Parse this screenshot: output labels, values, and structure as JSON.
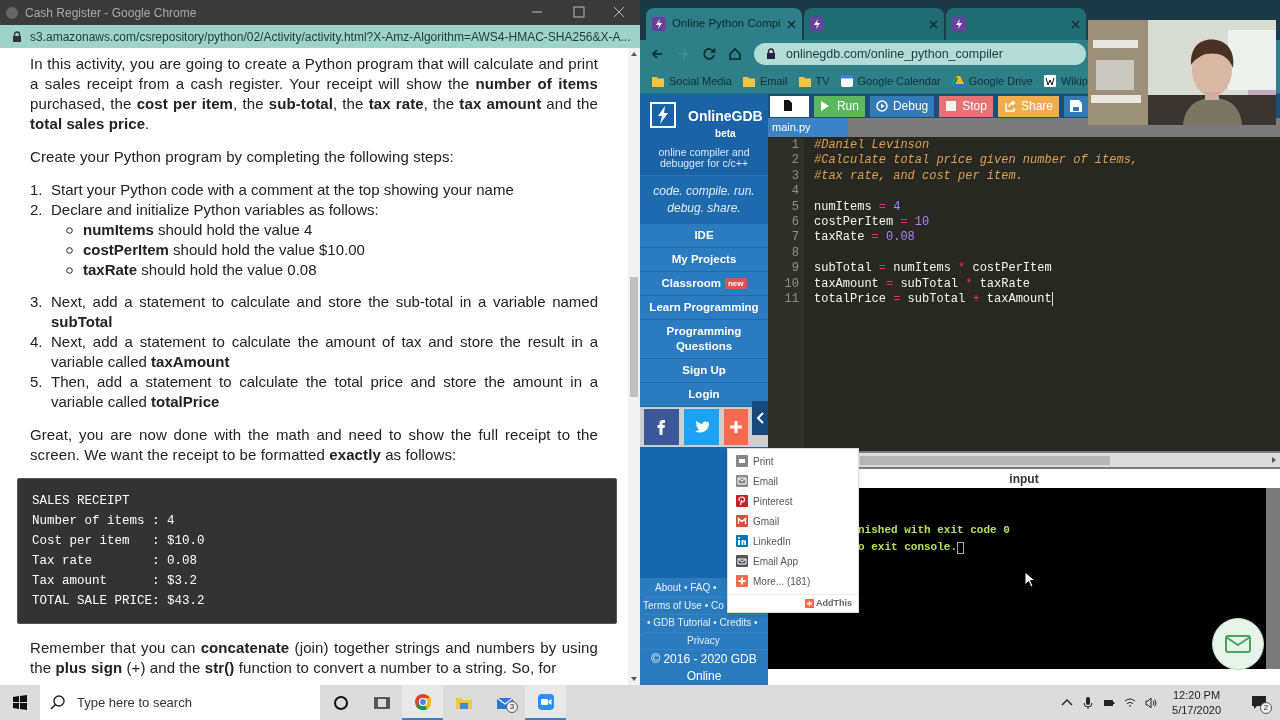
{
  "left_window": {
    "title": "Cash Register - Google Chrome",
    "url": "s3.amazonaws.com/csrepository/python/02/Activity/activity.html?X-Amz-Algorithm=AWS4-HMAC-SHA256&X-A...",
    "content": [
      {
        "kind": "paragraph",
        "text": "In this activity, you are going to create a Python program that will calculate and print a sales receipt from a cash register. Your receipt will show the **number of items** purchased, the **cost per item**, the **sub-total**, the **tax rate**, the **tax amount** and the **total sales price**."
      },
      {
        "kind": "paragraph",
        "text": "Create your Python program by completing the following steps:"
      },
      {
        "kind": "list",
        "items": [
          {
            "number": "1.",
            "text": "Start your Python code with a comment at the top showing your name"
          },
          {
            "number": "2.",
            "text": "Declare and initialize Python variables as follows:",
            "children": [
              {
                "text": "**numItems** should hold the value 4"
              },
              {
                "text": "**costPerItem** should hold the value $10.00"
              },
              {
                "text": "**taxRate** should hold the value 0.08"
              }
            ]
          },
          {
            "number": "3.",
            "text": "Next, add a statement to calculate and store the sub-total in a variable named **subTotal**"
          },
          {
            "number": "4.",
            "text": "Next, add a statement to calculate the amount of tax and store the result in a variable called **taxAmount**"
          },
          {
            "number": "5.",
            "text": "Then, add a statement to calculate the total price and store the amount in a variable called **totalPrice**"
          }
        ]
      },
      {
        "kind": "paragraph",
        "text": "Great, you are now done with the math and need to show the full receipt to the screen. We want the receipt to be formatted **exactly** as follows:"
      },
      {
        "kind": "code",
        "lines": [
          "SALES RECEIPT",
          "Number of items : 4",
          "Cost per item   : $10.0",
          "Tax rate        : 0.08",
          "Tax amount      : $3.2",
          "TOTAL SALE PRICE: $43.2"
        ]
      },
      {
        "kind": "paragraph",
        "text": "Remember that you can **concatenate** (join) together strings and numbers by using the **plus sign** (+) and the **str()** function to convert a number to a string. So, for"
      }
    ]
  },
  "right_window": {
    "tabs": [
      {
        "title": "Online Python Compi",
        "selected": true
      },
      {
        "selected": false
      },
      {
        "selected": false
      }
    ],
    "url": "onlinegdb.com/online_python_compiler",
    "bookmarks": [
      {
        "kind": "folder",
        "label": "Social Media"
      },
      {
        "kind": "folder",
        "label": "Email"
      },
      {
        "kind": "folder",
        "label": "TV"
      },
      {
        "kind": "calendar",
        "label": "Google Calendar"
      },
      {
        "kind": "drive",
        "label": "Google Drive"
      },
      {
        "kind": "wiki",
        "label": "Wikip"
      }
    ],
    "sidebar": {
      "brand": "OnlineGDB",
      "badge": "beta",
      "tagline": "online compiler and debugger for c/c++",
      "motto": "code. compile. run. debug. share.",
      "nav": [
        {
          "label": "IDE"
        },
        {
          "label": "My Projects"
        },
        {
          "label": "Classroom",
          "tag": "new"
        },
        {
          "label": "Learn Programming"
        },
        {
          "label": "Programming Questions"
        },
        {
          "label": "Sign Up"
        },
        {
          "label": "Login"
        }
      ],
      "social": [
        {
          "kind": "facebook"
        },
        {
          "kind": "twitter"
        },
        {
          "kind": "plus"
        }
      ],
      "footer_lines": [
        "About • FAQ •",
        "Terms of Use • Co",
        "• GDB Tutorial • Credits •",
        "Privacy"
      ],
      "copyright": "© 2016 - 2020 GDB Online"
    },
    "toolbar": [
      {
        "kind": "new_file"
      },
      {
        "kind": "run",
        "label": "Run"
      },
      {
        "kind": "debug",
        "label": "Debug"
      },
      {
        "kind": "stop",
        "label": "Stop"
      },
      {
        "kind": "share",
        "label": "Share"
      },
      {
        "kind": "save"
      }
    ],
    "file_tab": "main.py",
    "code": [
      {
        "n": "1",
        "text": "#Daniel Levinson"
      },
      {
        "n": "2",
        "text": "#Calculate total price given number of items,"
      },
      {
        "n": "3",
        "text": "#tax rate, and cost per item."
      },
      {
        "n": "4"
      },
      {
        "n": "5",
        "text": "numItems = 4"
      },
      {
        "n": "6",
        "text": "costPerItem = 10"
      },
      {
        "n": "7",
        "text": "taxRate = 0.08"
      },
      {
        "n": "8"
      },
      {
        "n": "9",
        "text": "subTotal = numItems * costPerItem"
      },
      {
        "n": "10",
        "text": "taxAmount = subTotal * taxRate"
      },
      {
        "n": "11",
        "text": "totalPrice = subTotal + taxAmount"
      }
    ],
    "output": {
      "header": "input",
      "lines": [
        "nished with exit code 0",
        "o exit console."
      ]
    },
    "share_menu": {
      "items": [
        {
          "kind": "print",
          "label": "Print"
        },
        {
          "kind": "email",
          "label": "Email"
        },
        {
          "kind": "pinterest",
          "label": "Pinterest"
        },
        {
          "kind": "gmail",
          "label": "Gmail"
        },
        {
          "kind": "linkedin",
          "label": "LinkedIn"
        },
        {
          "kind": "email_app",
          "label": "Email App"
        },
        {
          "kind": "more",
          "label": "More... (181)"
        }
      ],
      "footer": "AddThis"
    }
  },
  "taskbar": {
    "search_placeholder": "Type here to search",
    "apps": [
      {
        "kind": "cortana",
        "active": false
      },
      {
        "kind": "task_view",
        "active": false
      },
      {
        "kind": "chrome",
        "active": true
      },
      {
        "kind": "explorer",
        "active": false
      },
      {
        "kind": "mail",
        "active": false,
        "badge": "3"
      },
      {
        "kind": "zoom",
        "active": true
      }
    ],
    "tray": [
      {
        "kind": "chevron"
      },
      {
        "kind": "mic"
      },
      {
        "kind": "battery"
      },
      {
        "kind": "wifi"
      },
      {
        "kind": "volume"
      }
    ],
    "time": "12:20 PM",
    "date": "5/17/2020",
    "notifications": "2"
  }
}
